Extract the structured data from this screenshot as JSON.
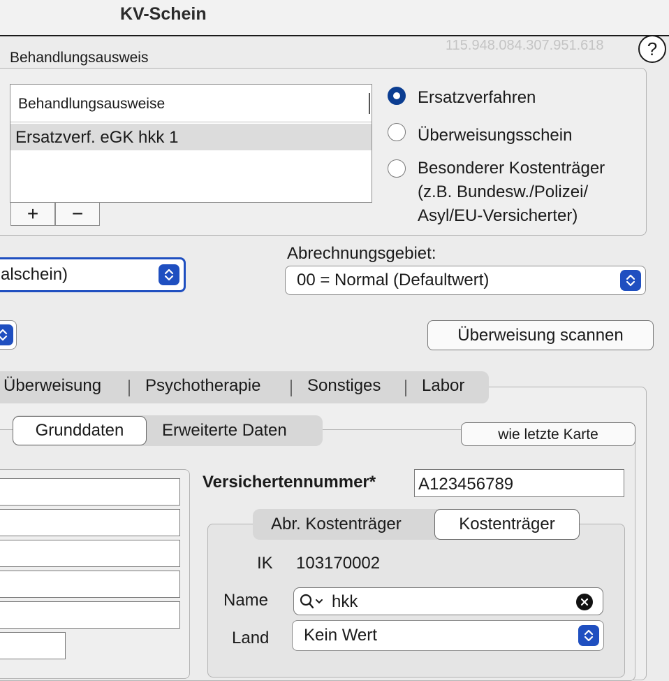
{
  "window": {
    "title": "KV-Schein",
    "id_number": "115.948.084.307.951.618",
    "help": "?"
  },
  "behandlungsausweis": {
    "group_label": "Behandlungsausweis",
    "list_header": "Behandlungsausweise",
    "items": [
      "Ersatzverf. eGK hkk 1"
    ],
    "add": "+",
    "remove": "−"
  },
  "schein_type": {
    "options": [
      {
        "label": "Ersatzverfahren",
        "selected": true
      },
      {
        "label": "Überweisungsschein",
        "selected": false
      },
      {
        "label": "Besonderer Kostenträger",
        "line2": "(z.B. Bundesw./Polizei/",
        "line3": "Asyl/EU-Versicherter)",
        "selected": false
      }
    ]
  },
  "scheinart_select": {
    "value": "alschein)"
  },
  "abrechnungsgebiet": {
    "label": "Abrechnungsgebiet:",
    "value": "00 = Normal (Defaultwert)"
  },
  "scan_button": "Überweisung scannen",
  "main_tabs": [
    "Überweisung",
    "Psychotherapie",
    "Sonstiges",
    "Labor"
  ],
  "sub_tabs": {
    "grunddaten": "Grunddaten",
    "erweitert": "Erweiterte Daten"
  },
  "wie_letzte_karte": "wie letzte Karte",
  "versichertennummer": {
    "label": "Versichertennummer*",
    "value": "A123456789"
  },
  "kostentraeger_tabs": {
    "abr": "Abr. Kostenträger",
    "kt": "Kostenträger"
  },
  "kostentraeger": {
    "ik_label": "IK",
    "ik_value": "103170002",
    "name_label": "Name",
    "name_value": "hkk",
    "land_label": "Land",
    "land_value": "Kein Wert"
  },
  "colors": {
    "accent": "#1f4fc0",
    "radio_selected": "#0b3d91"
  }
}
